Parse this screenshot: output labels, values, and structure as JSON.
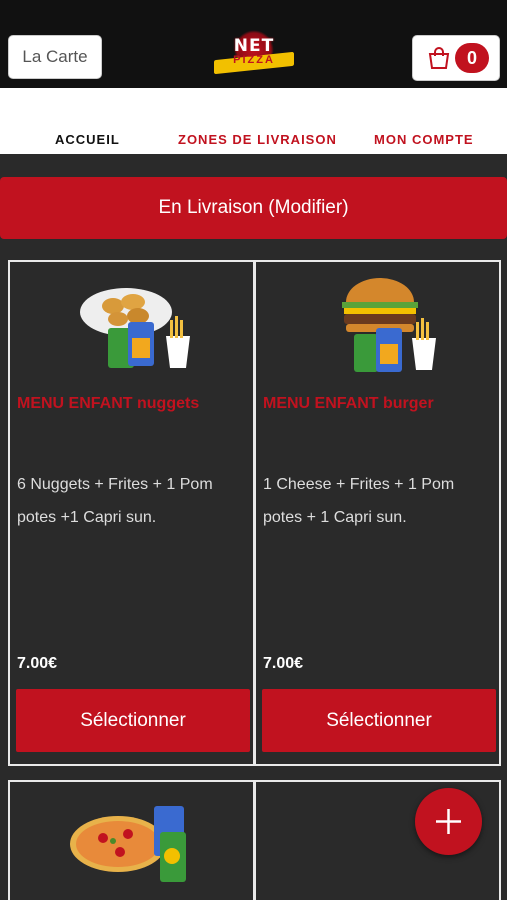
{
  "header": {
    "carte_label": "La Carte",
    "logo_top": "NET",
    "logo_bottom": "PIZZA",
    "cart_count": "0"
  },
  "nav": {
    "items": [
      {
        "label": "ACCUEIL"
      },
      {
        "label": "ZONES DE LIVRAISON"
      },
      {
        "label": "MON COMPTE"
      }
    ]
  },
  "delivery": {
    "label": "En Livraison (Modifier)"
  },
  "products": [
    {
      "title": "MENU ENFANT nuggets",
      "description": "6 Nuggets + Frites + 1 Pom potes +1 Capri sun.",
      "price": "7.00€",
      "button": "Sélectionner"
    },
    {
      "title": "MENU ENFANT burger",
      "description": "1 Cheese + Frites + 1 Pom potes + 1 Capri sun.",
      "price": "7.00€",
      "button": "Sélectionner"
    }
  ],
  "colors": {
    "accent": "#c1121f",
    "background": "#2a2a2a",
    "topbar": "#111111"
  }
}
